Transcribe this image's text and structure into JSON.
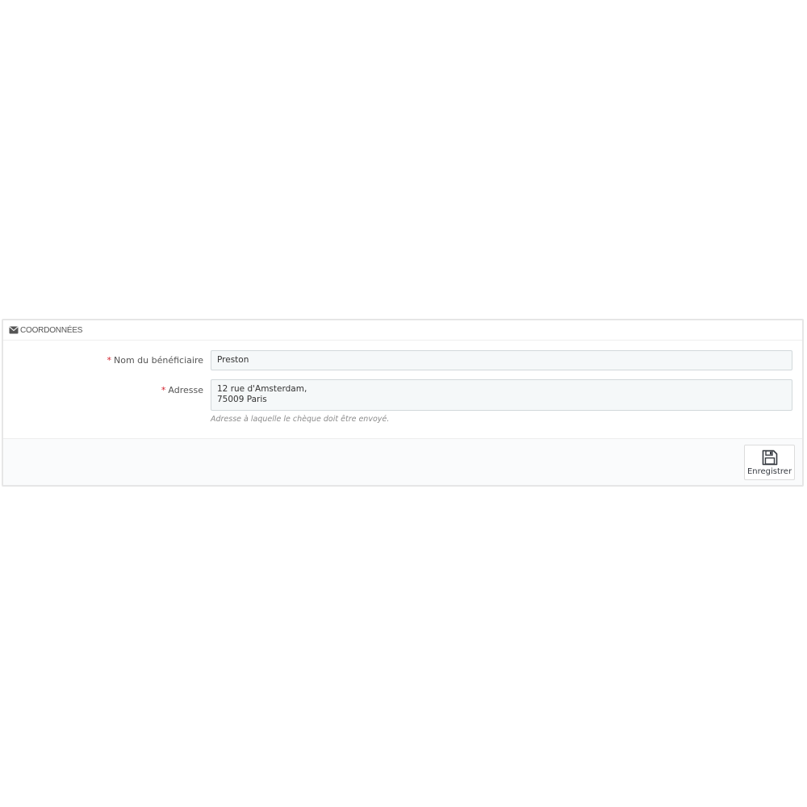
{
  "panel": {
    "heading_icon": "envelope-icon",
    "title": "COORDONNÉES"
  },
  "form": {
    "beneficiary": {
      "required_mark": "*",
      "label": "Nom du bénéficiaire",
      "value": "Preston"
    },
    "address": {
      "required_mark": "*",
      "label": "Adresse",
      "value": "12 rue d'Amsterdam,\n75009 Paris",
      "help": "Adresse à laquelle le chèque doit être envoyé."
    }
  },
  "footer": {
    "save_icon": "floppy-disk-icon",
    "save_label": "Enregistrer"
  },
  "colors": {
    "required": "#d2222d",
    "input_bg": "#f5f8f9",
    "border": "#e6e6e6"
  }
}
